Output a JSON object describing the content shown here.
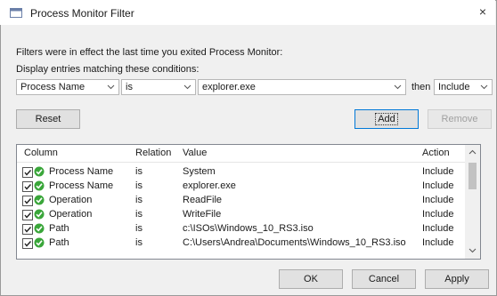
{
  "window": {
    "title": "Process Monitor Filter",
    "close": "×"
  },
  "info_text": "Filters were in effect the last time you exited Process Monitor:",
  "display_text": "Display entries matching these conditions:",
  "filter": {
    "column": "Process Name",
    "relation": "is",
    "value": "explorer.exe",
    "then_label": "then",
    "action": "Include"
  },
  "buttons": {
    "reset": "Reset",
    "add": "Add",
    "remove": "Remove",
    "ok": "OK",
    "cancel": "Cancel",
    "apply": "Apply"
  },
  "table": {
    "headers": [
      "Column",
      "Relation",
      "Value",
      "Action"
    ],
    "rows": [
      {
        "column": "Process Name",
        "relation": "is",
        "value": "System",
        "action": "Include"
      },
      {
        "column": "Process Name",
        "relation": "is",
        "value": "explorer.exe",
        "action": "Include"
      },
      {
        "column": "Operation",
        "relation": "is",
        "value": "ReadFile",
        "action": "Include"
      },
      {
        "column": "Operation",
        "relation": "is",
        "value": "WriteFile",
        "action": "Include"
      },
      {
        "column": "Path",
        "relation": "is",
        "value": "c:\\ISOs\\Windows_10_RS3.iso",
        "action": "Include"
      },
      {
        "column": "Path",
        "relation": "is",
        "value": "C:\\Users\\Andrea\\Documents\\Windows_10_RS3.iso",
        "action": "Include"
      }
    ]
  },
  "colors": {
    "accent": "#0078d7",
    "check_green": "#3aa63a"
  },
  "icons": {
    "app": "window-icon",
    "row": "green-check-icon",
    "chevron": "chevron-down-icon"
  }
}
